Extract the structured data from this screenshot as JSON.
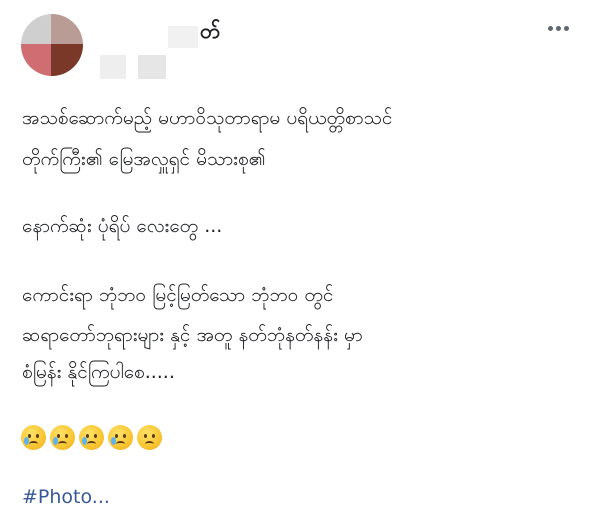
{
  "post": {
    "author_name_visible": "တ်",
    "more_menu_label": "•••",
    "lines": [
      "အသစ်ဆောက်မည့် မဟာဝိသုတာရာမ ပရိယတ္တိစာသင်",
      "တိုက်ကြီး၏ မြေအလှူရှင် မိသားစု၏",
      "နောက်ဆုံး ပုံရိပ် လေးတွေ ...",
      "ကောင်းရာ ဘုံဘဝ မြင့်မြတ်သော ဘုံဘဝ တွင်",
      "ဆရာတော်ဘုရားများ နှင့် အတူ နတ်ဘုံနတ်နန်း မှာ",
      "စံမြန်း နိုင်ကြပါစေ....."
    ],
    "emojis": [
      "crying-face",
      "crying-face",
      "crying-face",
      "crying-face",
      "sad-face"
    ],
    "hashtag_partial": "#Photo..."
  }
}
